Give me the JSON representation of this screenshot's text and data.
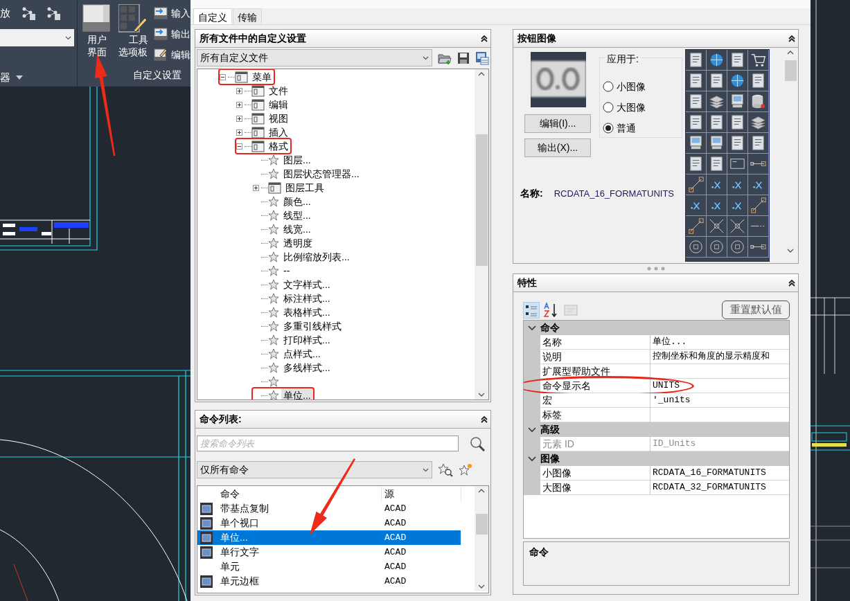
{
  "ribbon": {
    "partial_text": "放",
    "partial_group_label": "器",
    "customize_group": {
      "label": "自定义设置",
      "large_buttons": [
        {
          "label": "用户界面"
        },
        {
          "label": "工具选项板"
        }
      ],
      "small_buttons": [
        {
          "label": "输入"
        },
        {
          "label": "输出"
        },
        {
          "label": "编辑"
        }
      ]
    }
  },
  "tabs": [
    {
      "label": "自定义",
      "selected": true
    },
    {
      "label": "传输",
      "selected": false
    }
  ],
  "customizations_panel": {
    "title": "所有文件中的自定义设置",
    "file_filter": "所有自定义文件",
    "tree": [
      {
        "label": "菜单",
        "kind": "folder",
        "expanded": true,
        "highlighted": true,
        "selected": false,
        "children": [
          {
            "label": "文件",
            "kind": "folder",
            "expanded": false,
            "highlighted": false,
            "selected": false
          },
          {
            "label": "编辑",
            "kind": "folder",
            "expanded": false,
            "highlighted": false,
            "selected": false
          },
          {
            "label": "视图",
            "kind": "folder",
            "expanded": false,
            "highlighted": false,
            "selected": false
          },
          {
            "label": "插入",
            "kind": "folder",
            "expanded": false,
            "highlighted": false,
            "selected": false
          },
          {
            "label": "格式",
            "kind": "folder",
            "expanded": true,
            "highlighted": true,
            "selected": false,
            "children": [
              {
                "label": "图层...",
                "kind": "command",
                "highlighted": false,
                "selected": false
              },
              {
                "label": "图层状态管理器...",
                "kind": "command",
                "highlighted": false,
                "selected": false
              },
              {
                "label": "图层工具",
                "kind": "folder",
                "expanded": false,
                "highlighted": false,
                "selected": false
              },
              {
                "label": "颜色...",
                "kind": "command",
                "highlighted": false,
                "selected": false
              },
              {
                "label": "线型...",
                "kind": "command",
                "highlighted": false,
                "selected": false
              },
              {
                "label": "线宽...",
                "kind": "command",
                "highlighted": false,
                "selected": false
              },
              {
                "label": "透明度",
                "kind": "command",
                "highlighted": false,
                "selected": false
              },
              {
                "label": "比例缩放列表...",
                "kind": "command",
                "highlighted": false,
                "selected": false
              },
              {
                "label": "--",
                "kind": "command",
                "highlighted": false,
                "selected": false
              },
              {
                "label": "文字样式...",
                "kind": "command",
                "highlighted": false,
                "selected": false
              },
              {
                "label": "标注样式...",
                "kind": "command",
                "highlighted": false,
                "selected": false
              },
              {
                "label": "表格样式...",
                "kind": "command",
                "highlighted": false,
                "selected": false
              },
              {
                "label": "多重引线样式",
                "kind": "command",
                "highlighted": false,
                "selected": false
              },
              {
                "label": "打印样式...",
                "kind": "command",
                "highlighted": false,
                "selected": false
              },
              {
                "label": "点样式...",
                "kind": "command",
                "highlighted": false,
                "selected": false
              },
              {
                "label": "多线样式...",
                "kind": "command",
                "highlighted": false,
                "selected": false
              },
              {
                "kind": "command",
                "highlighted": false
              },
              {
                "label": "单位...",
                "kind": "command",
                "highlighted": true,
                "selected": true
              }
            ]
          }
        ]
      }
    ]
  },
  "command_list_panel": {
    "title": "命令列表:",
    "search": {
      "placeholder": "搜索命令列表"
    },
    "filter": "仅所有命令",
    "columns": [
      "命令",
      "源"
    ],
    "rows": [
      {
        "command": "带基点复制",
        "source": "ACAD",
        "has_icon": true,
        "selected": false
      },
      {
        "command": "单个视口",
        "source": "ACAD",
        "has_icon": true,
        "selected": false
      },
      {
        "command": "单位...",
        "source": "ACAD",
        "has_icon": true,
        "selected": true
      },
      {
        "command": "单行文字",
        "source": "ACAD",
        "has_icon": true,
        "selected": false
      },
      {
        "command": "单元",
        "source": "ACAD",
        "has_icon": false,
        "selected": false
      },
      {
        "command": "单元边框",
        "source": "ACAD",
        "has_icon": true,
        "selected": false
      }
    ]
  },
  "button_image_panel": {
    "title": "按钮图像",
    "buttons": [
      "编辑(I)...",
      "输出(X)..."
    ],
    "apply_to": {
      "label": "应用于:",
      "options": [
        {
          "label": "小图像",
          "selected": false
        },
        {
          "label": "大图像",
          "selected": false
        },
        {
          "label": "普通",
          "selected": true
        }
      ]
    },
    "name_label": "名称:",
    "name_value": "RCDATA_16_FORMATUNITS"
  },
  "properties_panel": {
    "title": "特性",
    "reset_button": {
      "label": "重置默认值",
      "disabled": true
    },
    "categories": [
      {
        "label": "命令",
        "expanded": true,
        "rows": [
          {
            "name": "名称",
            "value": "单位...",
            "disabled": false,
            "circled": false
          },
          {
            "name": "说明",
            "value": "控制坐标和角度的显示精度和",
            "disabled": false,
            "circled": false
          },
          {
            "name": "扩展型帮助文件",
            "disabled": false,
            "circled": false
          },
          {
            "name": "命令显示名",
            "value": "UNITS",
            "disabled": false,
            "circled": true
          },
          {
            "name": "宏",
            "value": "'_units",
            "disabled": false,
            "circled": false
          },
          {
            "name": "标签",
            "disabled": false,
            "circled": false
          }
        ]
      },
      {
        "label": "高级",
        "expanded": true,
        "rows": [
          {
            "name": "元素 ID",
            "value": "ID_Units",
            "disabled": true,
            "circled": false
          }
        ]
      },
      {
        "label": "图像",
        "expanded": true,
        "rows": [
          {
            "name": "小图像",
            "value": "RCDATA_16_FORMATUNITS",
            "disabled": false,
            "circled": false
          },
          {
            "name": "大图像",
            "value": "RCDATA_32_FORMATUNITS",
            "disabled": false,
            "circled": false
          }
        ]
      }
    ],
    "description_title": "命令"
  }
}
